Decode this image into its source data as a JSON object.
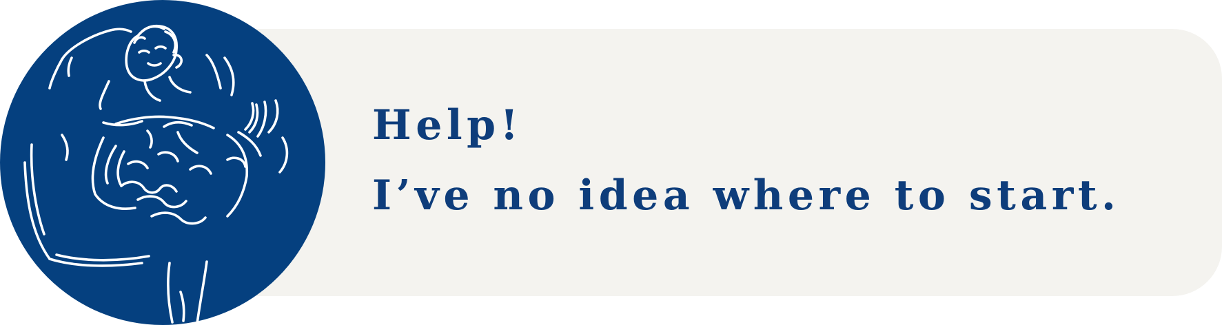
{
  "banner": {
    "headline_line1": "Help!",
    "headline_line2": "I’ve no idea where to start."
  },
  "illustration": {
    "icon": "confused-person-illustration-icon"
  },
  "colors": {
    "accent_blue": "#05407f",
    "text_blue": "#0e3d7b",
    "panel_background": "#f4f3ef",
    "line_art": "#ffffff"
  }
}
